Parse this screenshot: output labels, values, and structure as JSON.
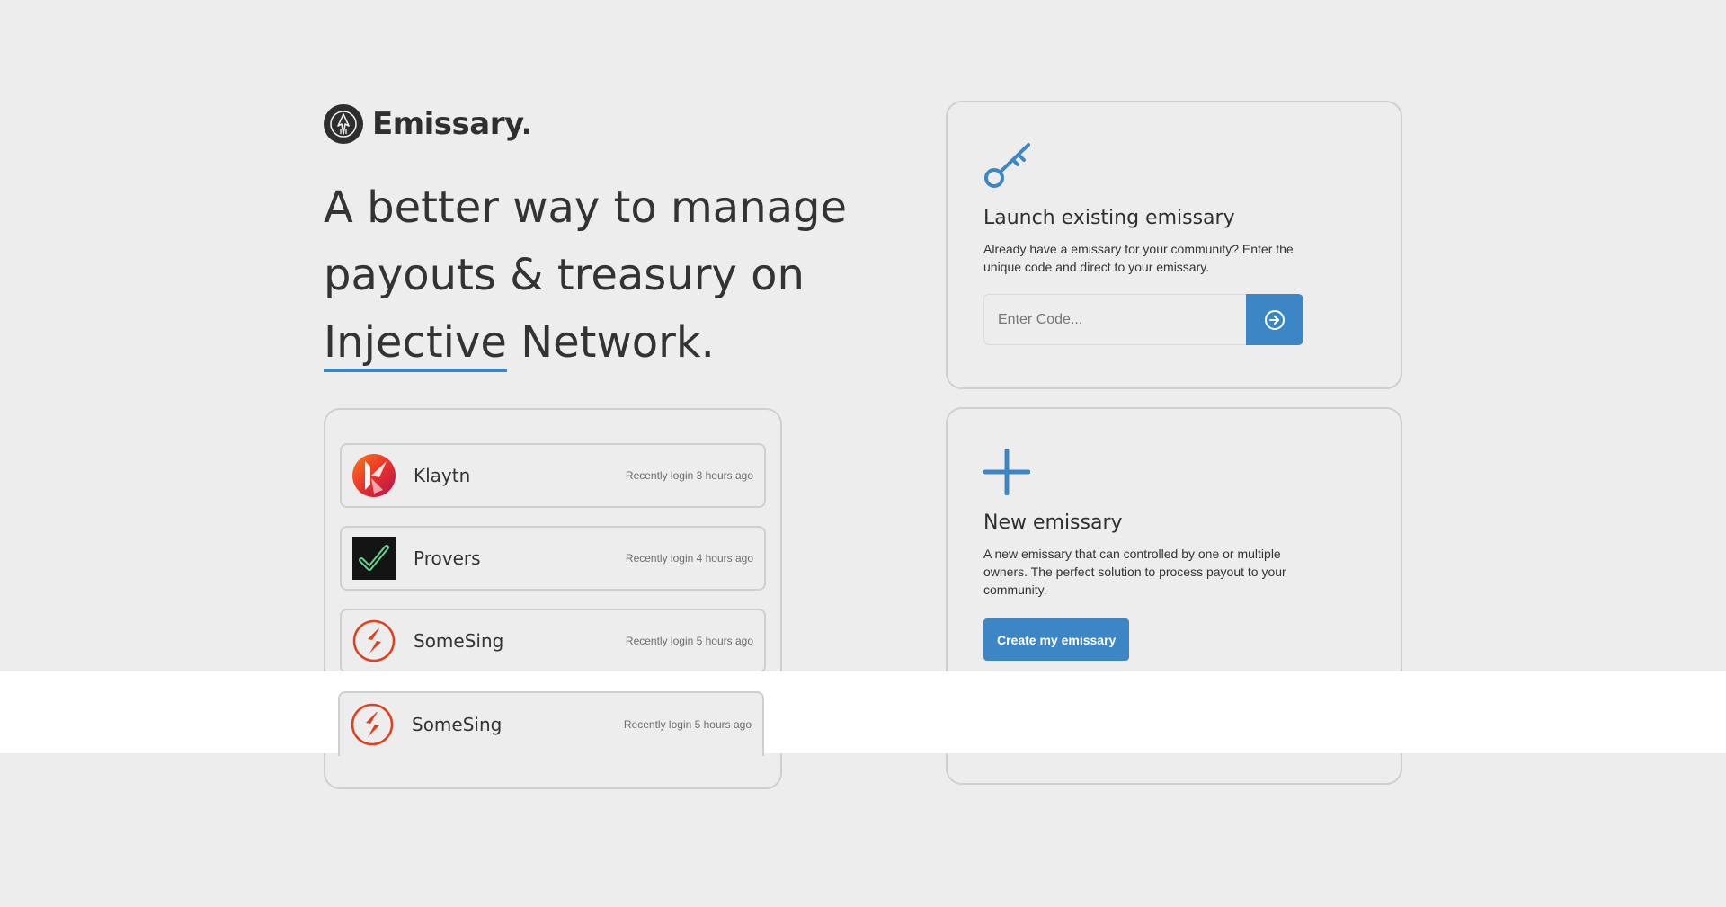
{
  "brand": {
    "name": "Emissary."
  },
  "headline": {
    "line1": "A better way to manage",
    "line2": "payouts & treasury on",
    "highlight": "Injective",
    "line3_rest": " Network."
  },
  "recent_logins": [
    {
      "name": "Klaytn",
      "time": "Recently login 3 hours ago",
      "icon": "klaytn-logo"
    },
    {
      "name": "Provers",
      "time": "Recently login 4 hours ago",
      "icon": "provers-logo"
    },
    {
      "name": "SomeSing",
      "time": "Recently login 5 hours ago",
      "icon": "somesing-logo"
    },
    {
      "name": "SomeSing",
      "time": "Recently login 5 hours ago",
      "icon": "somesing-logo"
    }
  ],
  "launch_card": {
    "icon": "key-icon",
    "title": "Launch existing emissary",
    "description": "Already have a emissary for your community? Enter the unique code and direct to your emissary.",
    "input_placeholder": "Enter Code...",
    "input_value": "",
    "submit_icon": "arrow-right-circle-icon"
  },
  "new_card": {
    "icon": "plus-icon",
    "title": "New emissary",
    "description": "A new emissary that can controlled by one or multiple owners. The perfect solution to process payout to your community.",
    "button_label": "Create my emissary"
  },
  "colors": {
    "accent": "#3d86c6",
    "background": "#ededed",
    "border": "#cfcfcf",
    "text": "#333333",
    "klaytn_red": "#e53a2c",
    "provers_green": "#5fd68f",
    "somesing_red": "#e0401e"
  }
}
